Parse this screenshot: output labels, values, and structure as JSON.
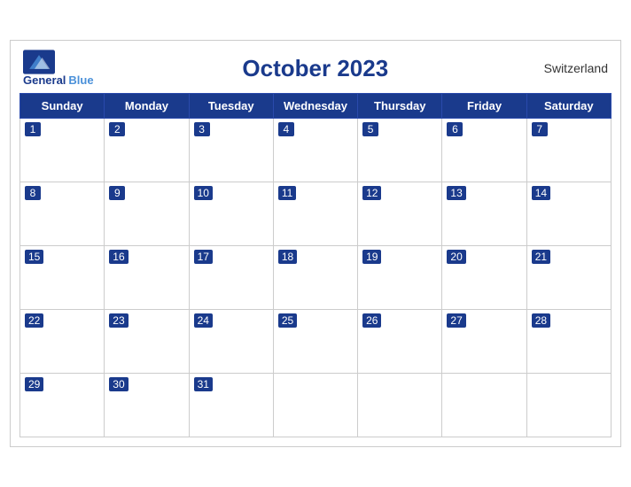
{
  "header": {
    "title": "October 2023",
    "country": "Switzerland",
    "logo_line1": "General",
    "logo_line2": "Blue"
  },
  "weekdays": [
    "Sunday",
    "Monday",
    "Tuesday",
    "Wednesday",
    "Thursday",
    "Friday",
    "Saturday"
  ],
  "weeks": [
    [
      {
        "day": 1,
        "empty": false
      },
      {
        "day": 2,
        "empty": false
      },
      {
        "day": 3,
        "empty": false
      },
      {
        "day": 4,
        "empty": false
      },
      {
        "day": 5,
        "empty": false
      },
      {
        "day": 6,
        "empty": false
      },
      {
        "day": 7,
        "empty": false
      }
    ],
    [
      {
        "day": 8,
        "empty": false
      },
      {
        "day": 9,
        "empty": false
      },
      {
        "day": 10,
        "empty": false
      },
      {
        "day": 11,
        "empty": false
      },
      {
        "day": 12,
        "empty": false
      },
      {
        "day": 13,
        "empty": false
      },
      {
        "day": 14,
        "empty": false
      }
    ],
    [
      {
        "day": 15,
        "empty": false
      },
      {
        "day": 16,
        "empty": false
      },
      {
        "day": 17,
        "empty": false
      },
      {
        "day": 18,
        "empty": false
      },
      {
        "day": 19,
        "empty": false
      },
      {
        "day": 20,
        "empty": false
      },
      {
        "day": 21,
        "empty": false
      }
    ],
    [
      {
        "day": 22,
        "empty": false
      },
      {
        "day": 23,
        "empty": false
      },
      {
        "day": 24,
        "empty": false
      },
      {
        "day": 25,
        "empty": false
      },
      {
        "day": 26,
        "empty": false
      },
      {
        "day": 27,
        "empty": false
      },
      {
        "day": 28,
        "empty": false
      }
    ],
    [
      {
        "day": 29,
        "empty": false
      },
      {
        "day": 30,
        "empty": false
      },
      {
        "day": 31,
        "empty": false
      },
      {
        "day": null,
        "empty": true
      },
      {
        "day": null,
        "empty": true
      },
      {
        "day": null,
        "empty": true
      },
      {
        "day": null,
        "empty": true
      }
    ]
  ]
}
